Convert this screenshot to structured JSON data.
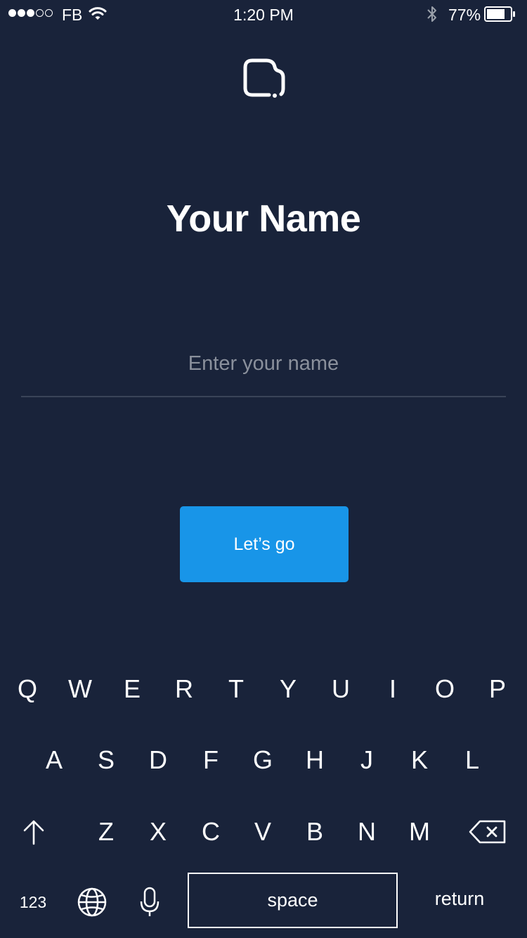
{
  "status_bar": {
    "carrier": "FB",
    "time": "1:20 PM",
    "battery_percent": "77%",
    "battery_level": 0.77,
    "signal_bars_filled": 3,
    "signal_bars_total": 5
  },
  "screen": {
    "title": "Your Name",
    "name_placeholder": "Enter your name",
    "name_value": "",
    "submit_label": "Let’s go"
  },
  "keyboard": {
    "row1": [
      "Q",
      "W",
      "E",
      "R",
      "T",
      "Y",
      "U",
      "I",
      "O",
      "P"
    ],
    "row2": [
      "A",
      "S",
      "D",
      "F",
      "G",
      "H",
      "J",
      "K",
      "L"
    ],
    "row3": [
      "Z",
      "X",
      "C",
      "V",
      "B",
      "N",
      "M"
    ],
    "numbers_label": "123",
    "space_label": "space",
    "return_label": "return"
  },
  "colors": {
    "background": "#19233a",
    "accent": "#1895e8",
    "text": "#ffffff",
    "placeholder": "#8a909c"
  },
  "icons": [
    "wifi-icon",
    "bluetooth-icon",
    "battery-icon",
    "app-logo",
    "shift-icon",
    "backspace-icon",
    "globe-icon",
    "microphone-icon"
  ]
}
